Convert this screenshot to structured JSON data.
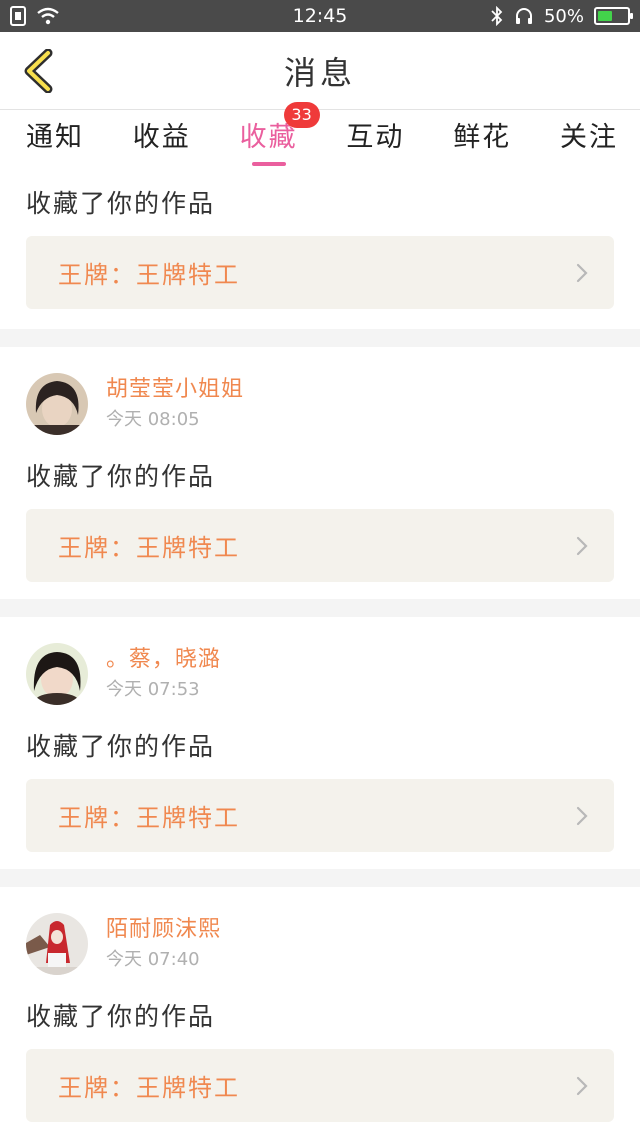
{
  "status_bar": {
    "time": "12:45",
    "battery": "50%",
    "battery_level": 0.5
  },
  "header": {
    "title": "消息"
  },
  "tabs": [
    {
      "label": "通知"
    },
    {
      "label": "收益"
    },
    {
      "label": "收藏",
      "badge": "33",
      "active": true
    },
    {
      "label": "互动"
    },
    {
      "label": "鲜花"
    },
    {
      "label": "关注"
    }
  ],
  "feed": {
    "first_item": {
      "action": "收藏了你的作品",
      "work": "王牌：王牌特工"
    },
    "items": [
      {
        "username": "胡莹莹小姐姐",
        "time": "今天 08:05",
        "action": "收藏了你的作品",
        "work": "王牌：王牌特工"
      },
      {
        "username": "。蔡，晓潞",
        "time": "今天 07:53",
        "action": "收藏了你的作品",
        "work": "王牌：王牌特工"
      },
      {
        "username": "陌耐顾沫熙",
        "time": "今天 07:40",
        "action": "收藏了你的作品",
        "work": "王牌：王牌特工"
      }
    ]
  },
  "colors": {
    "accent": "#ea5f9e",
    "username": "#f0884f",
    "badge": "#ef3a3a",
    "status_bar": "#4a4a4a"
  }
}
